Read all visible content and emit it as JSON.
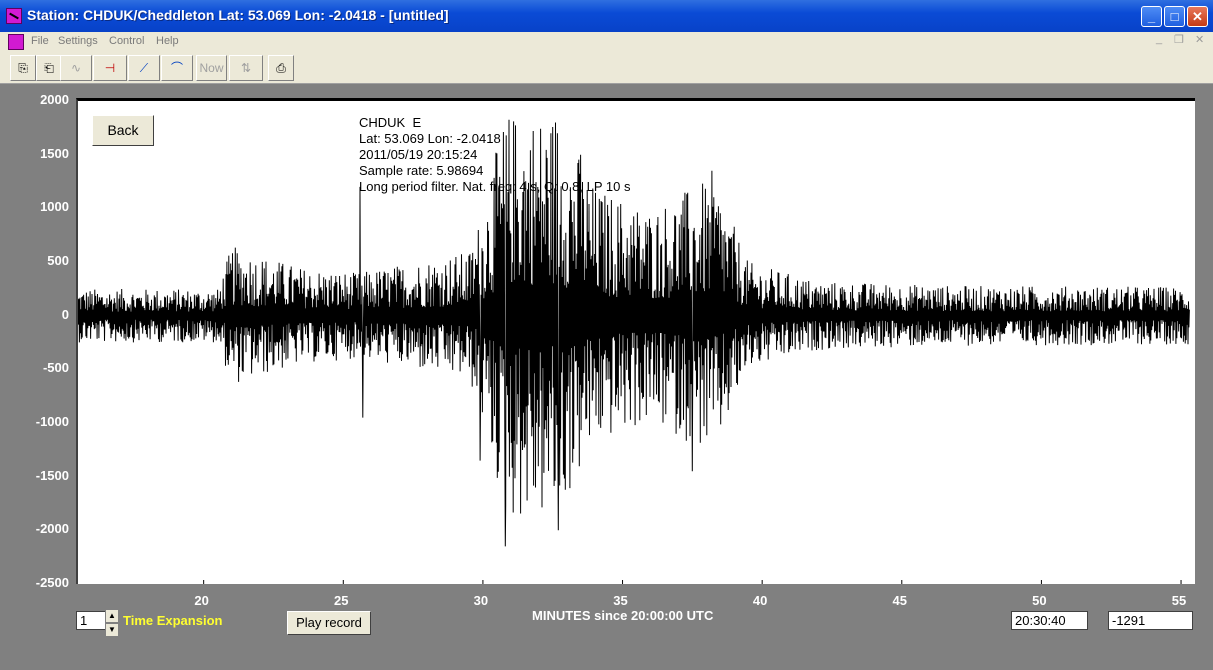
{
  "window": {
    "title": "Station: CHDUK/Cheddleton Lat: 53.069 Lon: -2.0418 - [untitled]",
    "buttons": {
      "minimize": "_",
      "maximize": "□",
      "close": "✕"
    }
  },
  "menu": {
    "items": [
      "File",
      "Settings",
      "Control",
      "Help"
    ],
    "mdi_controls": [
      "_",
      "❐",
      "✕"
    ]
  },
  "toolbar": {
    "buttons": [
      {
        "name": "open-file-button",
        "icon": "open-icon",
        "glyph": "⎘"
      },
      {
        "name": "copy-button",
        "icon": "copy-icon",
        "glyph": "⎗"
      },
      {
        "name": "waveform-button",
        "icon": "waveform-icon",
        "glyph": "∿"
      },
      {
        "name": "pick-button",
        "icon": "pick-icon",
        "glyph": "⊣"
      },
      {
        "name": "ramp-button",
        "icon": "ramp-icon",
        "glyph": "⟋"
      },
      {
        "name": "spectrum-button",
        "icon": "spectrum-icon",
        "glyph": "⌒"
      },
      {
        "name": "now-button",
        "icon": "now-icon",
        "glyph": "Now"
      },
      {
        "name": "updown-button",
        "icon": "updown-arrows-icon",
        "glyph": "⇅"
      },
      {
        "name": "print-button",
        "icon": "printer-icon",
        "glyph": "⎙"
      }
    ]
  },
  "plot": {
    "back_label": "Back",
    "info_lines": [
      "CHDUK  E",
      "Lat: 53.069 Lon: -2.0418",
      "2011/05/19 20:15:24",
      "Sample rate: 5.98694",
      "Long period filter. Nat. freq: 4 s, Q: 0.8, LP 10 s"
    ],
    "x_axis_label": "MINUTES since 20:00:00 UTC",
    "time_expansion_value": "1",
    "time_expansion_label": "Time Expansion",
    "play_label": "Play record",
    "cursor_time": "20:30:40",
    "cursor_value": "-1291"
  },
  "chart_data": {
    "type": "line",
    "title": "",
    "xlabel": "MINUTES since 20:00:00 UTC",
    "ylabel": "",
    "xlim": [
      15.5,
      55.5
    ],
    "ylim": [
      -2500,
      2000
    ],
    "xticks": [
      20,
      25,
      30,
      35,
      40,
      45,
      50,
      55
    ],
    "yticks": [
      2000,
      1500,
      1000,
      500,
      0,
      -500,
      -1000,
      -1500,
      -2000,
      -2500
    ],
    "grid": false,
    "series": [
      {
        "color": "#000000",
        "envelope": {
          "x": [
            15.5,
            20.5,
            21.0,
            23.5,
            25.5,
            29.5,
            30.0,
            30.8,
            32.7,
            34.0,
            36.0,
            37.5,
            38.3,
            39.5,
            42.0,
            47.0,
            55.5
          ],
          "amplitude": [
            250,
            250,
            650,
            450,
            400,
            600,
            1000,
            1900,
            1900,
            1200,
            1000,
            1200,
            1300,
            500,
            320,
            280,
            270
          ]
        },
        "peaks": [
          {
            "x": 25.6,
            "y": 1200
          },
          {
            "x": 25.7,
            "y": -950
          },
          {
            "x": 29.9,
            "y": -1350
          },
          {
            "x": 30.8,
            "y": -2150
          },
          {
            "x": 32.6,
            "y": 1800
          },
          {
            "x": 32.7,
            "y": -2000
          },
          {
            "x": 33.5,
            "y": 1500
          },
          {
            "x": 37.5,
            "y": -1450
          },
          {
            "x": 38.2,
            "y": 1350
          }
        ]
      }
    ]
  },
  "colors": {
    "titlebar": "#0a4bd6",
    "background": "#808080",
    "plot_bg": "#ffffff",
    "trace": "#000000",
    "time_expansion_label": "#ffff30"
  }
}
